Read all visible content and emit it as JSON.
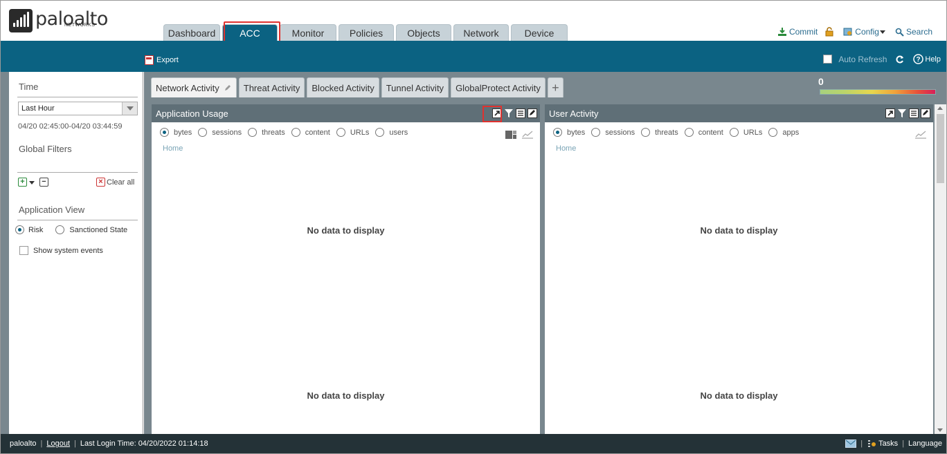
{
  "brand": {
    "name": "paloalto",
    "sub": "NETWORKS"
  },
  "main_tabs": [
    {
      "label": "Dashboard",
      "active": false
    },
    {
      "label": "ACC",
      "active": true
    },
    {
      "label": "Monitor",
      "active": false
    },
    {
      "label": "Policies",
      "active": false
    },
    {
      "label": "Objects",
      "active": false
    },
    {
      "label": "Network",
      "active": false
    },
    {
      "label": "Device",
      "active": false
    }
  ],
  "top_actions": {
    "commit": "Commit",
    "config": "Config",
    "search": "Search"
  },
  "toolbar": {
    "export": "Export",
    "auto_refresh": "Auto Refresh",
    "help": "Help"
  },
  "sidebar": {
    "time_title": "Time",
    "time_value": "Last Hour",
    "time_range": "04/20 02:45:00-04/20 03:44:59",
    "global_filters_title": "Global Filters",
    "clear_all": "Clear all",
    "application_view_title": "Application View",
    "view_risk": "Risk",
    "view_sanctioned": "Sanctioned State",
    "show_system_events": "Show system events"
  },
  "sub_tabs": [
    {
      "label": "Network Activity",
      "active": true
    },
    {
      "label": "Threat Activity",
      "active": false
    },
    {
      "label": "Blocked Activity",
      "active": false
    },
    {
      "label": "Tunnel Activity",
      "active": false
    },
    {
      "label": "GlobalProtect Activity",
      "active": false
    }
  ],
  "legend_min": "0",
  "panels": {
    "app_usage": {
      "title": "Application Usage",
      "options": [
        "bytes",
        "sessions",
        "threats",
        "content",
        "URLs",
        "users"
      ],
      "home": "Home",
      "nodata": "No data to display"
    },
    "user_activity": {
      "title": "User Activity",
      "options": [
        "bytes",
        "sessions",
        "threats",
        "content",
        "URLs",
        "apps"
      ],
      "home": "Home",
      "nodata": "No data to display"
    }
  },
  "footer": {
    "user": "paloalto",
    "logout": "Logout",
    "last_login": "Last Login Time: 04/20/2022 01:14:18",
    "tasks": "Tasks",
    "language": "Language"
  }
}
